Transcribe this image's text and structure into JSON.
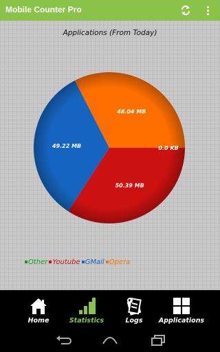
{
  "app": {
    "title": "Mobile Counter Pro"
  },
  "toolbar": {
    "refresh_icon": "refresh-icon",
    "overflow_icon": "overflow-menu-icon"
  },
  "chart_data": {
    "type": "pie",
    "title": "Applications (From Today)",
    "unit": "MB",
    "slices": [
      {
        "name": "Other",
        "value": 0.0,
        "label": "0.0 KB",
        "color": "#159a1c"
      },
      {
        "name": "Youtube",
        "value": 50.39,
        "label": "50.39 MB",
        "color": "#cc1111"
      },
      {
        "name": "GMail",
        "value": 49.22,
        "label": "49.22 MB",
        "color": "#1565c0"
      },
      {
        "name": "Opera",
        "value": 48.04,
        "label": "48.04 MB",
        "color": "#ff6f00"
      }
    ]
  },
  "legend": {
    "items": [
      {
        "label": "Other",
        "color": "#159a1c"
      },
      {
        "label": "Youtube",
        "color": "#cc1111"
      },
      {
        "label": "GMail",
        "color": "#1565c0"
      },
      {
        "label": "Opera",
        "color": "#ff6f00"
      }
    ]
  },
  "nav": {
    "items": [
      {
        "label": "Home",
        "icon": "home-icon",
        "active": false
      },
      {
        "label": "Statistics",
        "icon": "statistics-icon",
        "active": true
      },
      {
        "label": "Logs",
        "icon": "logs-icon",
        "active": false
      },
      {
        "label": "Applications",
        "icon": "applications-icon",
        "active": false
      }
    ]
  },
  "system_bar": {
    "back_icon": "back-icon",
    "home_icon": "home-button-icon",
    "recents_icon": "recents-icon"
  },
  "colors": {
    "accent": "#8bc34a",
    "nav_bg": "#000000"
  }
}
